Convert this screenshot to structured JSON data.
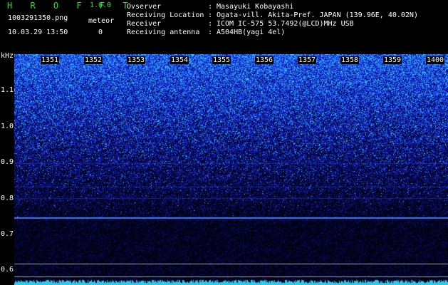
{
  "header": {
    "app_title": "H R O F F T",
    "app_version": "1.0.0",
    "filename": "1003291350.png",
    "datetime": "10.03.29 13:50",
    "meteor_label": "meteor",
    "meteor_count": "0"
  },
  "info": [
    {
      "key": "Ovserver",
      "sep": ":",
      "value": "Masayuki Kobayashi"
    },
    {
      "key": "Receiving Location",
      "sep": ":",
      "value": "Ogata-vill. Akita-Pref. JAPAN (139.96E, 40.02N)"
    },
    {
      "key": "Receiver",
      "sep": ":",
      "value": "ICOM IC-575 53.7492(@LCD)MHz USB"
    },
    {
      "key": "Receiving antenna",
      "sep": ":",
      "value": "A504HB(yagi 4el)"
    }
  ],
  "yaxis": {
    "unit": "kHz",
    "ticks": [
      "1.1",
      "1.0",
      "0.9",
      "0.8",
      "0.7",
      "0.6"
    ]
  },
  "xaxis": {
    "ticks": [
      "1351",
      "1352",
      "1353",
      "1354",
      "1355",
      "1356",
      "1357",
      "1358",
      "1359",
      "1400"
    ]
  },
  "colors": {
    "title": "#1ee61e",
    "noise_high": "#28c8ff",
    "noise_mid": "#2a3cff",
    "noise_low": "#081060",
    "carrier": "#3c78ff",
    "baseline": "#30c8e6",
    "ref_line": "#a0a0a0"
  }
}
